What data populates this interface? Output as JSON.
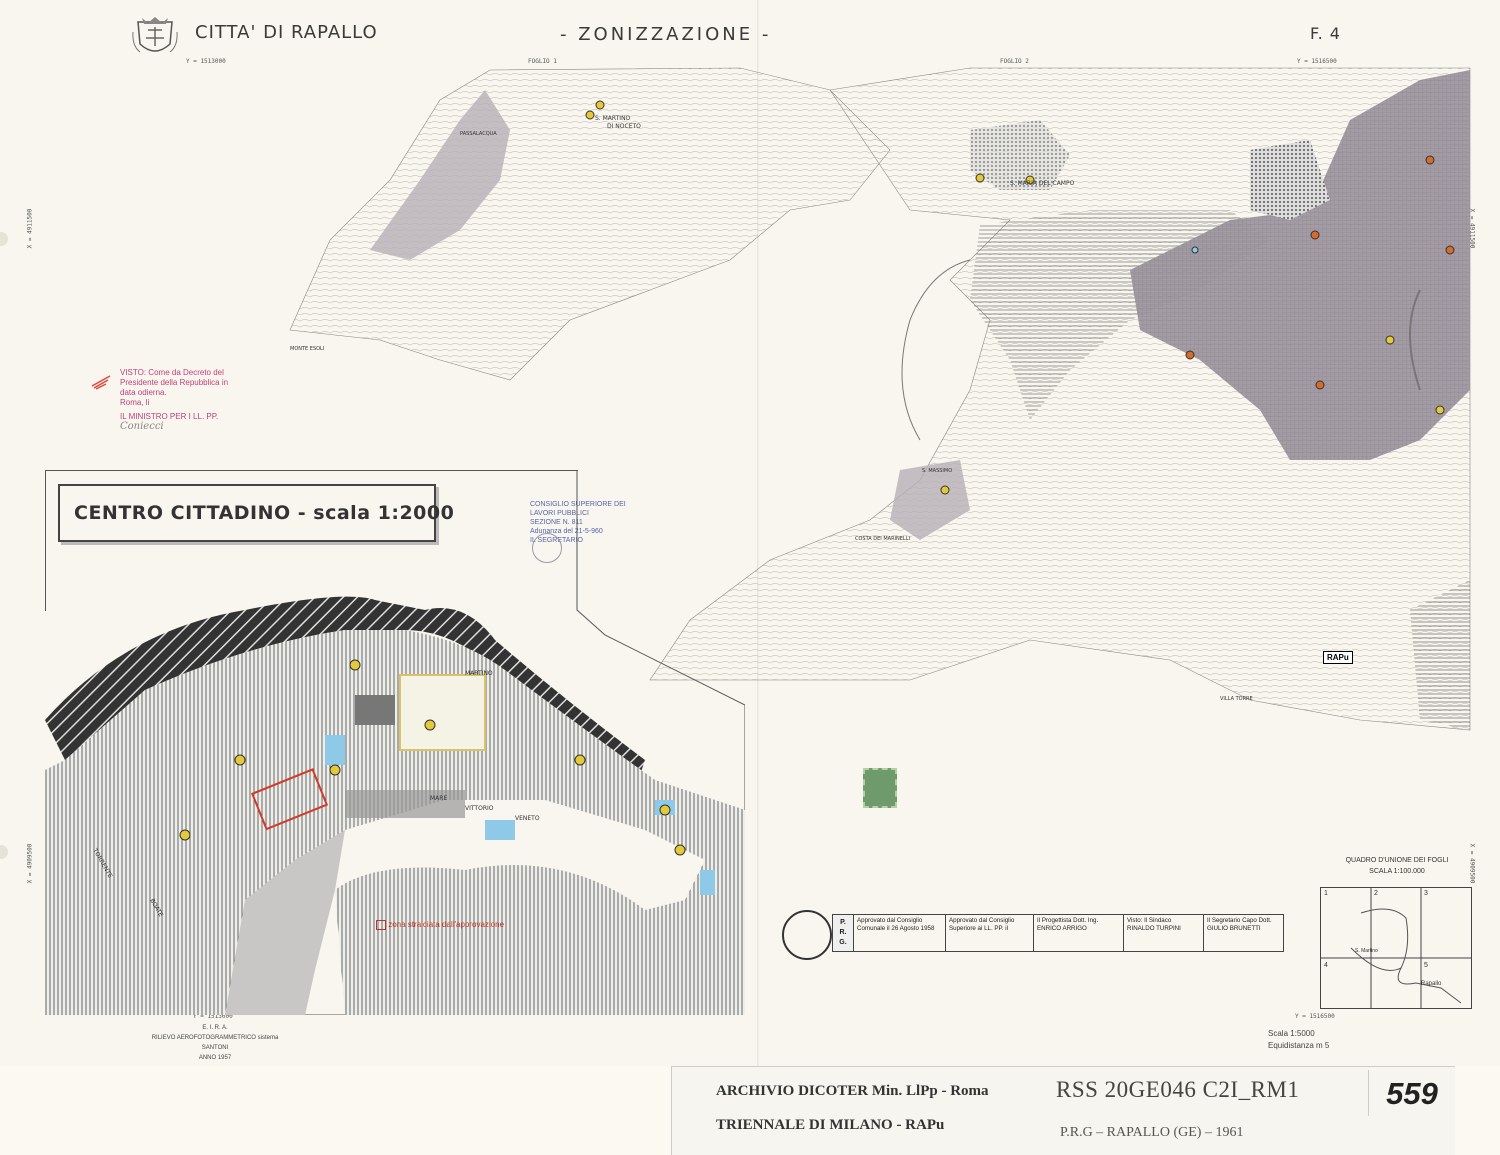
{
  "header": {
    "city": "CITTA' DI RAPALLO",
    "title": "- ZONIZZAZIONE -",
    "sheet": "F. 4"
  },
  "coords": {
    "top_left": "Y = 1513000",
    "top_mid": "FOGLIO 1",
    "top_mid2": "FOGLIO 2",
    "top_right": "Y = 1516500",
    "left_x1": "X = 4911500",
    "left_x2": "X = 4909500",
    "right_x1": "X = 4911500",
    "right_x2": "X = 4909500",
    "bottom_left": "Y = 1513000",
    "bottom_right": "Y = 1516500"
  },
  "places": {
    "s_martino": "S. MARTINO",
    "di_noceto": "DI NOCETO",
    "passalacqua": "PASSALACQUA",
    "monte_esoli": "MONTE ESOLI",
    "s_maria_campo": "S. MARIA DEL CAMPO",
    "s_massimo": "S. MASSIMO",
    "costa_marinelli": "COSTA DEI MARINELLI",
    "villa_torre": "VILLA TORRE",
    "torrente": "TORRENTE",
    "boate": "BOATE",
    "martino": "MARTINO",
    "mare": "MARE",
    "vittorio": "VITTORIO",
    "veneto": "VENETO"
  },
  "stamps": {
    "visto": "VISTO: Come da Decreto del Presidente della Repubblica in data odierna.",
    "roma": "Roma, li",
    "ministro": "IL MINISTRO PER I LL. PP.",
    "signature": "Coniecci",
    "consiglio": "CONSIGLIO SUPERIORE DEI LAVORI PUBBLICI",
    "sezione": "SEZIONE N. 811",
    "adunanza": "Adunanza del 21-5-960",
    "segretario": "IL SEGRETARIO"
  },
  "inset": {
    "title": "CENTRO CITTADINO - scala 1:2000",
    "note": "zona stralciata dall'approvazione"
  },
  "approval_table": {
    "prg": "P. R. G.",
    "col1": "Approvato dal Consiglio Comunale il 26 Agosto 1958",
    "col2": "Approvato dal Consiglio Superiore ai LL. PP. il",
    "col3": "Il Progettista Dott. Ing. ENRICO ARRIGO",
    "col4": "Visto: Il Sindaco RINALDO TURPINI",
    "col5": "Il Segretario Capo Dott. GIULIO BRUNETTI"
  },
  "legend": {
    "rapu": "RAPu",
    "quadro_title": "QUADRO D'UNIONE DEI FOGLI",
    "quadro_scale": "SCALA 1:100.000",
    "cells": [
      "1",
      "2",
      "3",
      "4",
      "5"
    ],
    "towns": [
      "Rapallo",
      "S. Martino"
    ]
  },
  "footer": {
    "scale": "Scala 1:5000",
    "equidistanza": "Equidistanza m 5",
    "eira": "E. I. R. A.",
    "rilievo": "RILIEVO AEROFOTOGRAMMETRICO sistema SANTONI",
    "anno": "ANNO 1957"
  },
  "archive": {
    "line1": "ARCHIVIO DICOTER Min. LlPp - Roma",
    "line2": "TRIENNALE DI MILANO - RAPu",
    "code": "RSS 20GE046 C2I_RM1",
    "sub": "P.R.G – RAPALLO (GE) – 1961",
    "number": "559"
  },
  "colors": {
    "paper": "#f8f6ee",
    "hatch": "#555555",
    "zone_gray": "#9a929c",
    "zone_light": "#cfc9cf",
    "blue_marker": "#8ec9e8",
    "orange_marker": "#d86a2a",
    "yellow_marker": "#e5c93a"
  }
}
